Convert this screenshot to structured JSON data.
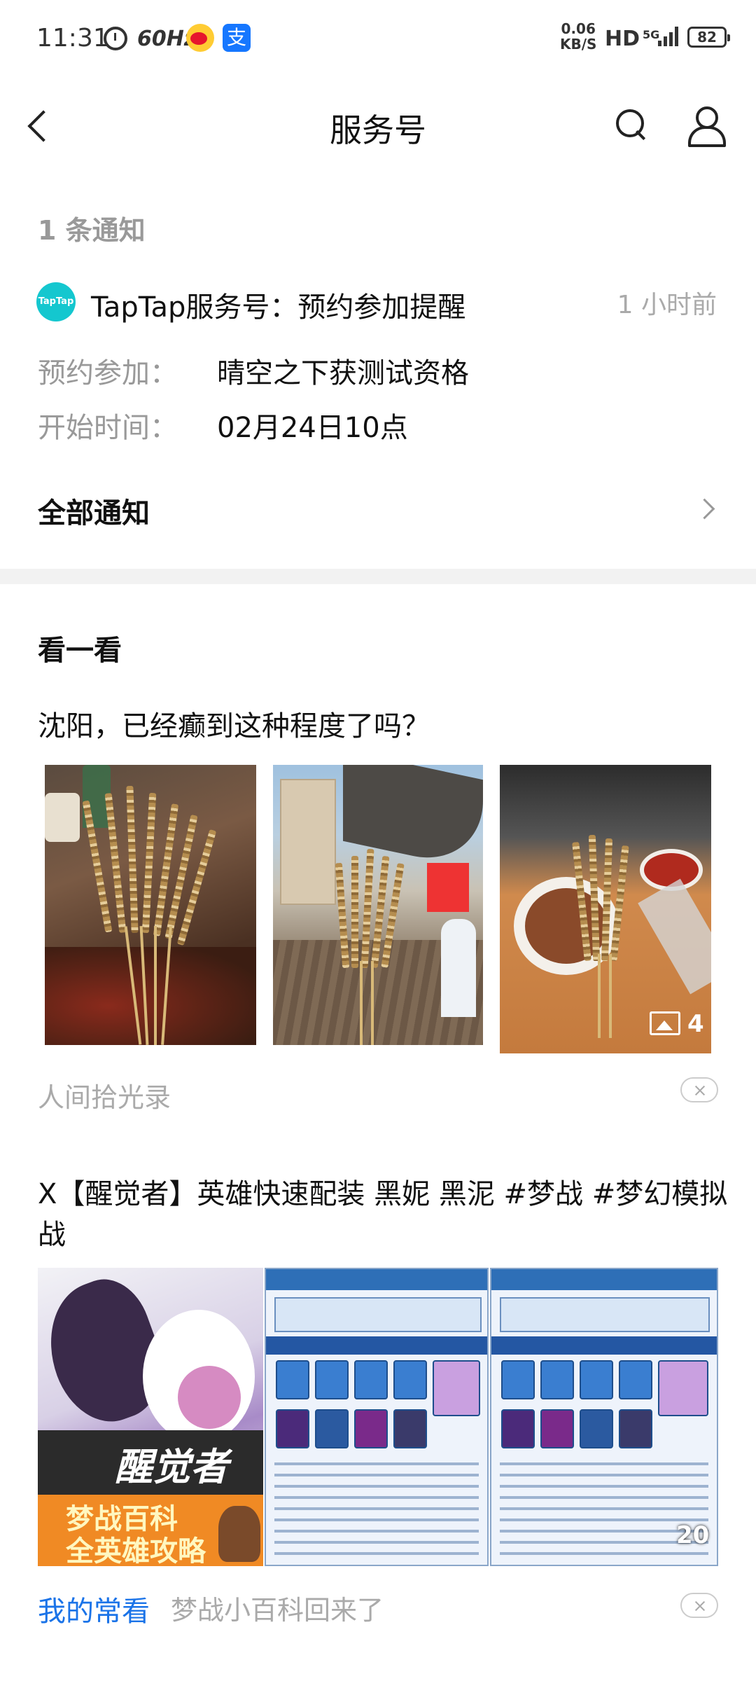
{
  "status_bar": {
    "time": "11:31",
    "refresh_rate": "60Hz",
    "net_speed_value": "0.06",
    "net_speed_unit": "KB/S",
    "hd": "HD",
    "network": "5G",
    "battery": "82",
    "alipay_glyph": "支"
  },
  "header": {
    "title": "服务号"
  },
  "notifications": {
    "count_label": "1 条通知",
    "logo_text": "TapTap",
    "item": {
      "title": "TapTap服务号：预约参加提醒",
      "time": "1 小时前",
      "rows": [
        {
          "label": "预约参加：",
          "value": "晴空之下获测试资格"
        },
        {
          "label": "开始时间：",
          "value": "02月24日10点"
        }
      ]
    },
    "all_label": "全部通知"
  },
  "feed": {
    "section_title": "看一看",
    "posts": [
      {
        "title": "沈阳，已经癫到这种程度了吗？",
        "source": "人间拾光录",
        "image_count": "4"
      },
      {
        "title": "X【醒觉者】英雄快速配装 黑妮 黑泥 #梦战 #梦幻模拟战",
        "tag": "我的常看",
        "source": "梦战小百科回来了",
        "image_count": "20",
        "cover_line1": "醒觉者",
        "cover_line2": "梦战百科",
        "cover_line3": "全英雄攻略"
      }
    ]
  },
  "colors": {
    "accent": "#1a73e8",
    "taptap": "#14c7cf",
    "muted": "#999999"
  }
}
